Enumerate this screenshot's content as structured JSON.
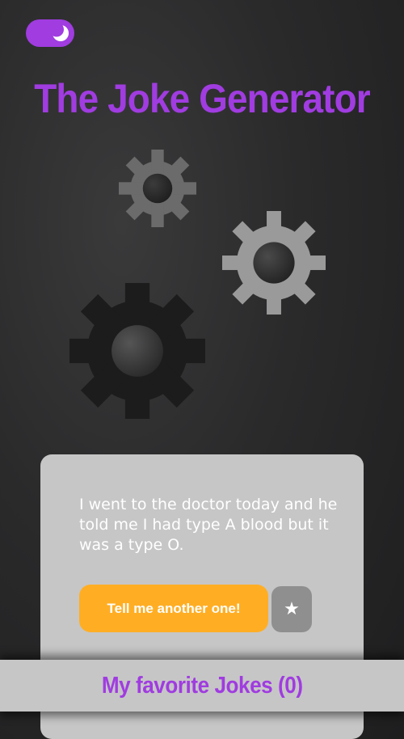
{
  "header": {
    "title": "The Joke Generator",
    "theme_toggle": {
      "mode": "dark",
      "icon": "moon-icon"
    }
  },
  "colors": {
    "accent": "#a03ce0",
    "button": "#ffae24",
    "card": "#c6c6c6",
    "star_button": "#8f8f8f",
    "gear_small": "#6b6b6b",
    "gear_medium": "#9a9a9a",
    "gear_large": "#1c1c1c"
  },
  "decor": {
    "icons": [
      "gear-icon",
      "gear-icon",
      "gear-icon"
    ]
  },
  "joke_card": {
    "joke": "I went to the doctor today and he told me I had type A blood but it was a type O.",
    "next_label": "Tell me another one!",
    "favorite_symbol": "★"
  },
  "favorites_bar": {
    "label": "My favorite Jokes (0)"
  }
}
